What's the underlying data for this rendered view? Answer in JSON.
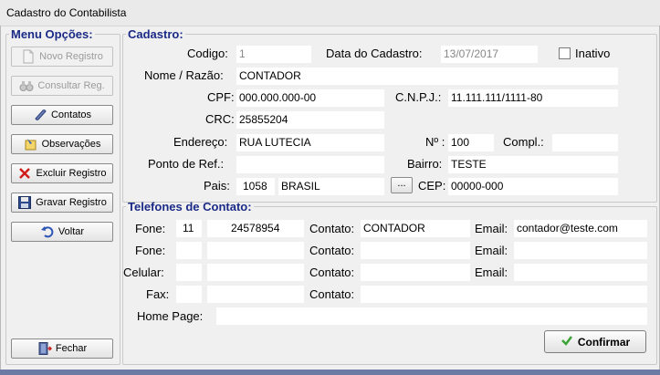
{
  "window": {
    "title": "Cadastro do Contabilista"
  },
  "menu": {
    "legend": "Menu Opções:",
    "buttons": {
      "novo": "Novo Registro",
      "consultar": "Consultar Reg.",
      "contatos": "Contatos",
      "observacoes": "Observações",
      "excluir": "Excluir Registro",
      "gravar": "Gravar Registro",
      "voltar": "Voltar",
      "fechar": "Fechar"
    }
  },
  "cadastro": {
    "legend": "Cadastro:",
    "labels": {
      "codigo": "Codigo:",
      "data": "Data do Cadastro:",
      "inativo": "Inativo",
      "nome": "Nome / Razão:",
      "cpf": "CPF:",
      "cnpj": "C.N.P.J.:",
      "crc": "CRC:",
      "endereco": "Endereço:",
      "numero": "Nº :",
      "compl": "Compl.:",
      "ponto": "Ponto de Ref.:",
      "bairro": "Bairro:",
      "pais": "Pais:",
      "cep": "CEP:"
    },
    "values": {
      "codigo": "1",
      "data": "13/07/2017",
      "nome": "CONTADOR",
      "cpf": "000.000.000-00",
      "cnpj": "11.111.111/1111-80",
      "crc": "25855204",
      "endereco": "RUA LUTECIA",
      "numero": "100",
      "compl": "",
      "ponto": "",
      "bairro": "TESTE",
      "pais_codigo": "1058",
      "pais_nome": "BRASIL",
      "cep": "00000-000"
    },
    "lookup_button": "..."
  },
  "telefones": {
    "legend": "Telefones de Contato:",
    "labels": {
      "fone": "Fone:",
      "celular": "Celular:",
      "fax": "Fax:",
      "contato": "Contato:",
      "email": "Email:",
      "homepage": "Home Page:"
    },
    "rows": [
      {
        "ddd": "11",
        "numero": "24578954",
        "contato": "CONTADOR",
        "email": "contador@teste.com"
      },
      {
        "ddd": "",
        "numero": "",
        "contato": "",
        "email": ""
      },
      {
        "ddd": "",
        "numero": "",
        "contato": "",
        "email": ""
      },
      {
        "ddd": "",
        "numero": "",
        "contato": ""
      }
    ],
    "homepage": ""
  },
  "confirm_button": "Confirmar",
  "colors": {
    "legend": "#1a2a86",
    "bottom_strip": "#6d7aa3"
  },
  "icons": {
    "novo": "document-icon",
    "consultar": "binoculars-icon",
    "contatos": "phone-icon",
    "observacoes": "notes-icon",
    "excluir": "red-x-icon",
    "gravar": "floppy-disk-icon",
    "voltar": "undo-arrow-icon",
    "fechar": "exit-door-icon",
    "confirmar": "green-check-icon"
  }
}
